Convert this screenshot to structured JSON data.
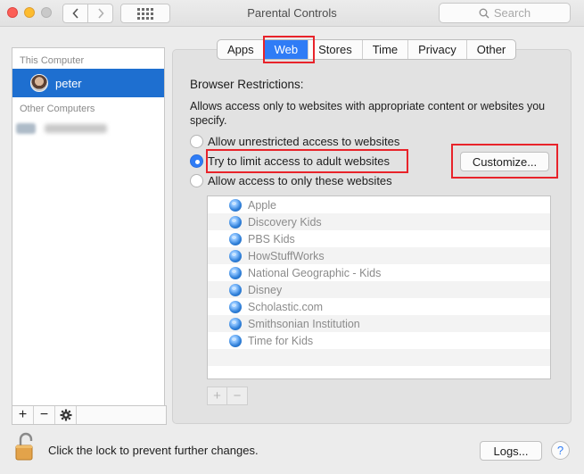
{
  "window": {
    "title": "Parental Controls"
  },
  "search": {
    "placeholder": "Search"
  },
  "sidebar": {
    "this_computer_label": "This Computer",
    "selected_user": "peter",
    "other_computers_label": "Other Computers"
  },
  "tabs": [
    "Apps",
    "Web",
    "Stores",
    "Time",
    "Privacy",
    "Other"
  ],
  "active_tab": "Web",
  "web": {
    "heading": "Browser Restrictions:",
    "description": "Allows access only to websites with appropriate content or websites you specify.",
    "options": [
      {
        "label": "Allow unrestricted access to websites",
        "selected": false
      },
      {
        "label": "Try to limit access to adult websites",
        "selected": true
      },
      {
        "label": "Allow access to only these websites",
        "selected": false
      }
    ],
    "customize_label": "Customize...",
    "sites": [
      "Apple",
      "Discovery Kids",
      "PBS Kids",
      "HowStuffWorks",
      "National Geographic - Kids",
      "Disney",
      "Scholastic.com",
      "Smithsonian Institution",
      "Time for Kids"
    ]
  },
  "footer": {
    "lock_text": "Click the lock to prevent further changes.",
    "logs_label": "Logs...",
    "help_label": "?"
  },
  "colors": {
    "accent": "#2f7cf6",
    "highlight": "#e8232a",
    "selection": "#1e6fd0"
  }
}
